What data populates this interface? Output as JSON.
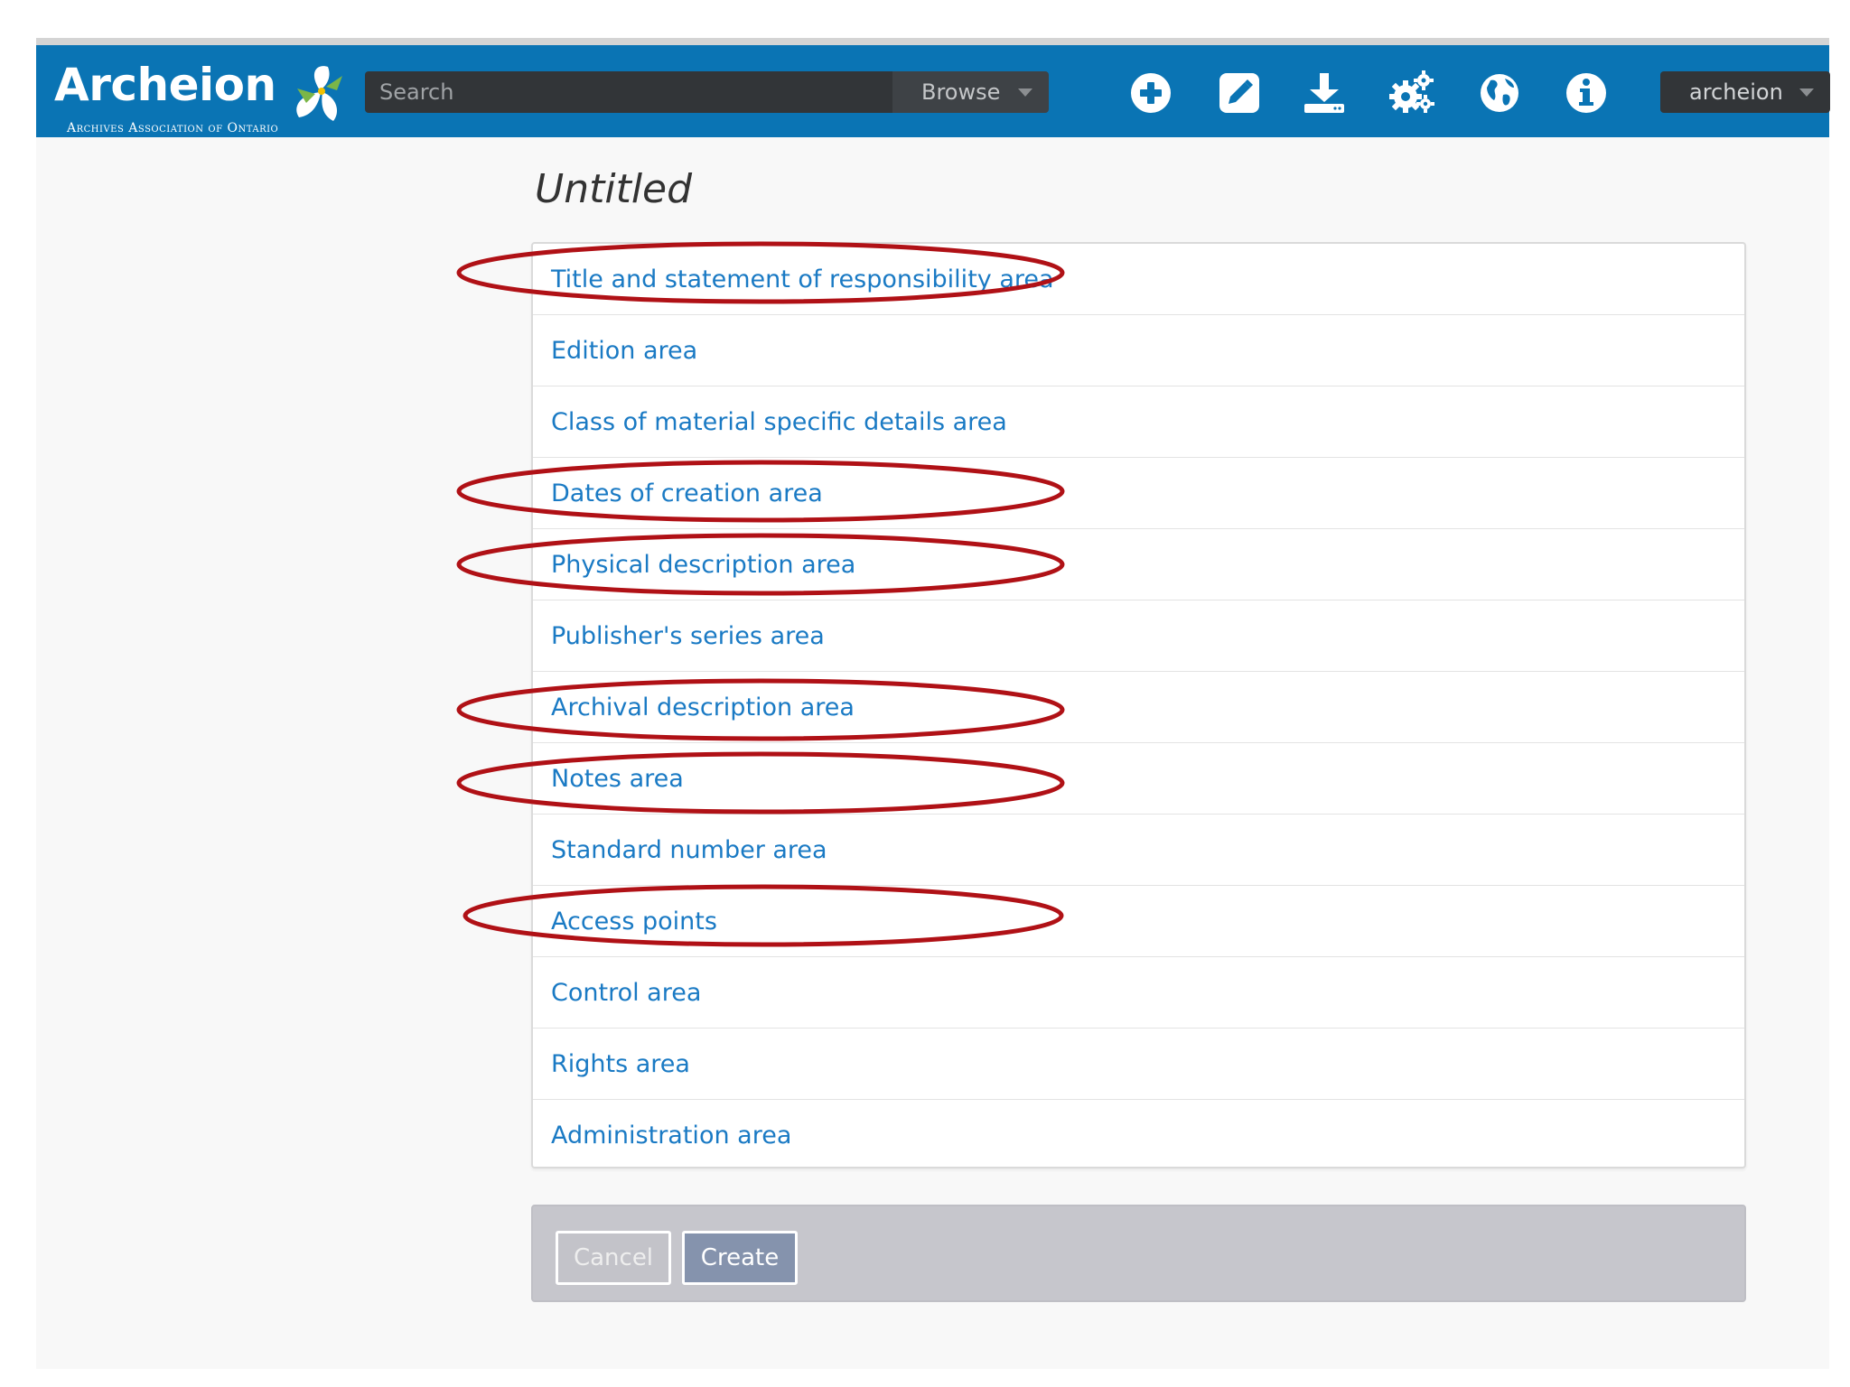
{
  "app": {
    "name": "Archeion",
    "subtitle": "Archives Association of Ontario"
  },
  "header": {
    "search_placeholder": "Search",
    "browse_label": "Browse",
    "user_label": "archeion",
    "icons": [
      "plus-circle-icon",
      "edit-pencil-icon",
      "download-icon",
      "gears-icon",
      "globe-icon",
      "info-icon"
    ]
  },
  "page": {
    "title": "Untitled"
  },
  "sections": [
    {
      "label": "Title and statement of responsibility area"
    },
    {
      "label": "Edition area"
    },
    {
      "label": "Class of material specific details area"
    },
    {
      "label": "Dates of creation area"
    },
    {
      "label": "Physical description area"
    },
    {
      "label": "Publisher's series area"
    },
    {
      "label": "Archival description area"
    },
    {
      "label": "Notes area"
    },
    {
      "label": "Standard number area"
    },
    {
      "label": "Access points"
    },
    {
      "label": "Control area"
    },
    {
      "label": "Rights area"
    },
    {
      "label": "Administration area"
    }
  ],
  "actions": {
    "cancel_label": "Cancel",
    "create_label": "Create"
  },
  "colors": {
    "header_bg": "#0a74b4",
    "link": "#1a7ac4",
    "annotation": "#b01116",
    "create_button": "#8593ad"
  }
}
